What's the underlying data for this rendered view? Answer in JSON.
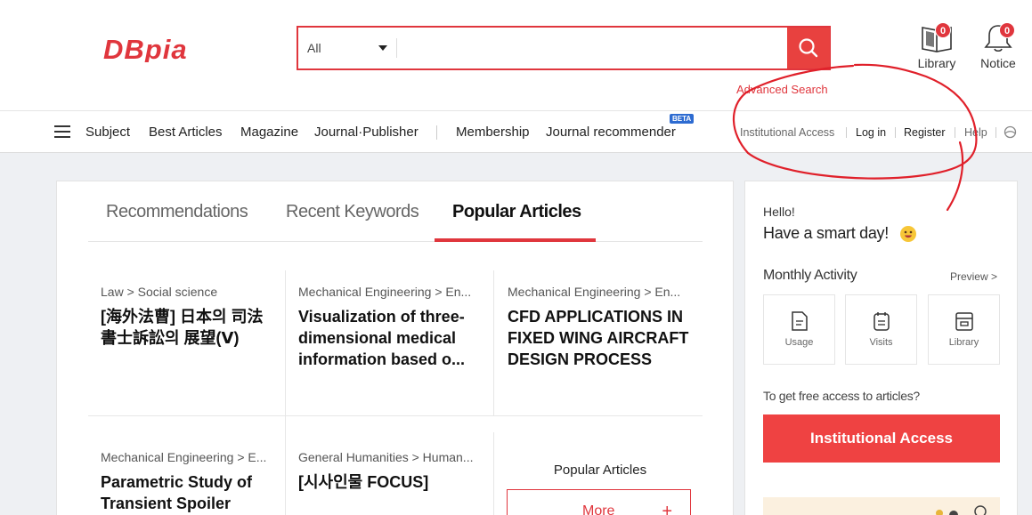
{
  "header": {
    "logo_text": "DBpia",
    "search": {
      "scope": "All",
      "value": "",
      "placeholder": ""
    },
    "advanced_search": "Advanced Search",
    "library": {
      "label": "Library",
      "count": "0"
    },
    "notice": {
      "label": "Notice",
      "count": "0"
    }
  },
  "nav": {
    "items": [
      "Subject",
      "Best Articles",
      "Magazine",
      "Journal·Publisher",
      "Membership",
      "Journal recommender"
    ],
    "beta_badge": "BETA",
    "utility": [
      "Institutional Access",
      "Log in",
      "Register",
      "Help"
    ]
  },
  "main": {
    "tabs": [
      "Recommendations",
      "Recent Keywords",
      "Popular Articles"
    ],
    "active_tab": "Popular Articles",
    "articles": [
      {
        "category": "Law > Social science",
        "title": "[海外法曹] 日本의 司法書士訴訟의 展望(Ⅴ)"
      },
      {
        "category": "Mechanical Engineering > En...",
        "title": "Visualization of three-dimensional medical information based o..."
      },
      {
        "category": "Mechanical Engineering > En...",
        "title": "CFD APPLICATIONS IN FIXED WING AIRCRAFT DESIGN PROCESS"
      },
      {
        "category": "Mechanical Engineering > E...",
        "title": "Parametric Study of Transient Spoiler"
      },
      {
        "category": "General Humanities > Human...",
        "title": "[시사인물 FOCUS]"
      }
    ],
    "popular_label": "Popular Articles",
    "more_label": "More",
    "more_icon": "+"
  },
  "side": {
    "hello": "Hello!",
    "greeting": "Have a smart day!",
    "monthly_activity": "Monthly Activity",
    "preview": "Preview >",
    "activities": [
      "Usage",
      "Visits",
      "Library"
    ],
    "free_access_text": "To get free access to articles?",
    "institutional_button": "Institutional Access"
  },
  "colors": {
    "brand_red": "#e0363d",
    "button_red": "#ef4242",
    "beta_blue": "#2d6bd1"
  }
}
